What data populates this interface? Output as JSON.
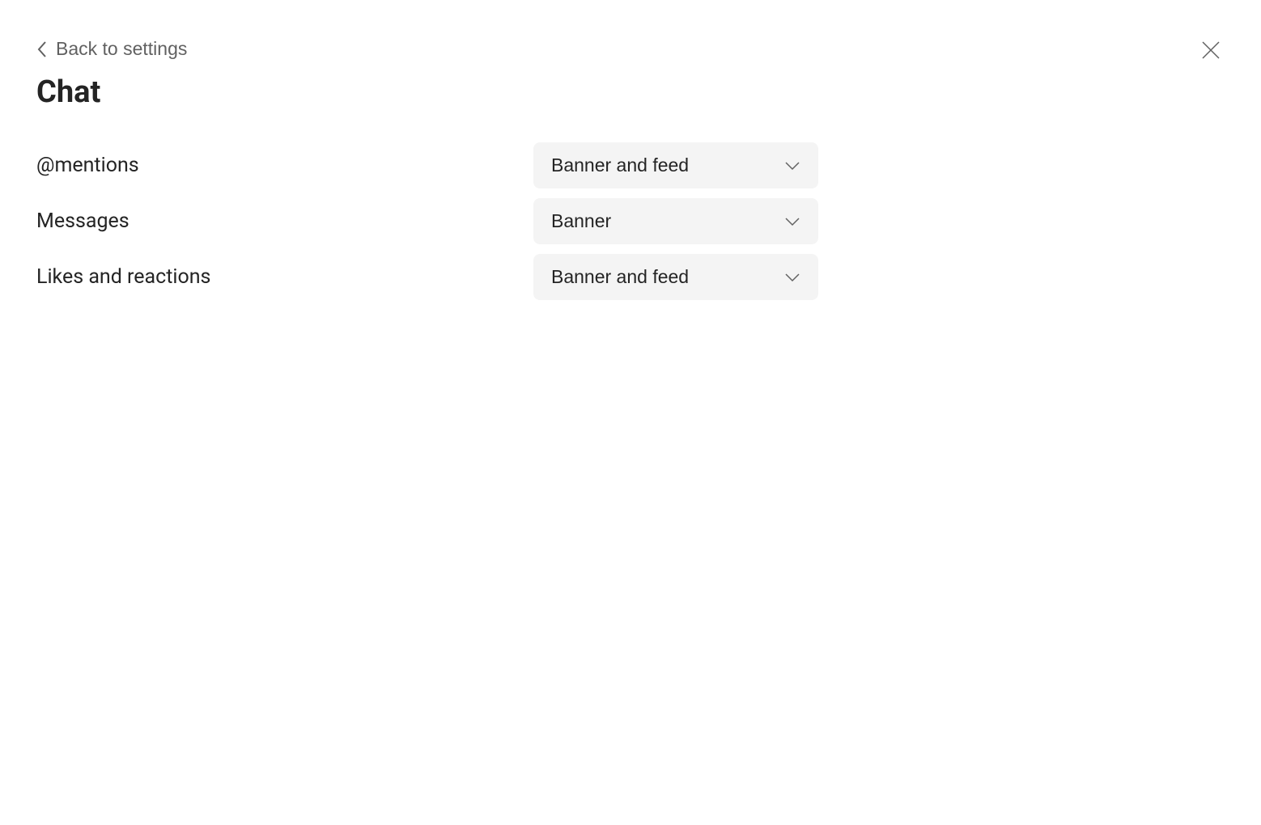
{
  "header": {
    "back_label": "Back to settings",
    "title": "Chat"
  },
  "settings": [
    {
      "label": "@mentions",
      "value": "Banner and feed"
    },
    {
      "label": "Messages",
      "value": "Banner"
    },
    {
      "label": "Likes and reactions",
      "value": "Banner and feed"
    }
  ]
}
